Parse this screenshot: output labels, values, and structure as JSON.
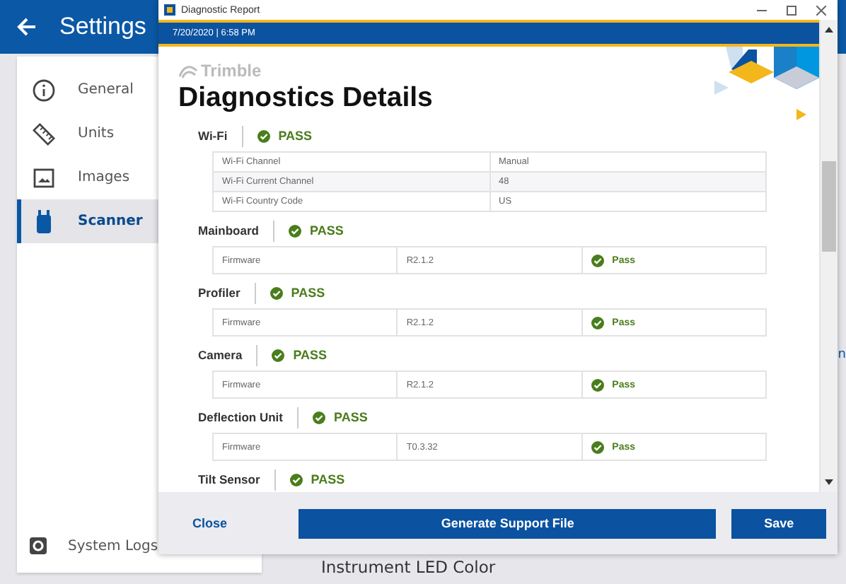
{
  "settings": {
    "title": "Settings",
    "nav_items": [
      {
        "label": "General",
        "selected": false
      },
      {
        "label": "Units",
        "selected": false
      },
      {
        "label": "Images",
        "selected": false
      },
      {
        "label": "Scanner",
        "selected": true
      }
    ],
    "footer_item": {
      "label": "System Logs"
    },
    "section_heading": "Instrument LED Color",
    "edge_fragments": [
      "n"
    ]
  },
  "dialog": {
    "title": "Diagnostic Report",
    "timestamp": "7/20/2020 | 6:58 PM",
    "logo": "Trimble",
    "heading": "Diagnostics Details",
    "sections": [
      {
        "name": "Wi-Fi",
        "status": "PASS",
        "rows": [
          {
            "label": "Wi-Fi Channel",
            "value": "Manual"
          },
          {
            "label": "Wi-Fi Current Channel",
            "value": "48"
          },
          {
            "label": "Wi-Fi Country Code",
            "value": "US"
          }
        ]
      },
      {
        "name": "Mainboard",
        "status": "PASS",
        "rows": [
          {
            "label": "Firmware",
            "value": "R2.1.2",
            "result": "Pass"
          }
        ]
      },
      {
        "name": "Profiler",
        "status": "PASS",
        "rows": [
          {
            "label": "Firmware",
            "value": "R2.1.2",
            "result": "Pass"
          }
        ]
      },
      {
        "name": "Camera",
        "status": "PASS",
        "rows": [
          {
            "label": "Firmware",
            "value": "R2.1.2",
            "result": "Pass"
          }
        ]
      },
      {
        "name": "Deflection Unit",
        "status": "PASS",
        "rows": [
          {
            "label": "Firmware",
            "value": "T0.3.32",
            "result": "Pass"
          }
        ]
      },
      {
        "name": "Tilt Sensor",
        "status": "PASS"
      }
    ],
    "buttons": {
      "close": "Close",
      "generate": "Generate Support File",
      "save": "Save"
    }
  }
}
